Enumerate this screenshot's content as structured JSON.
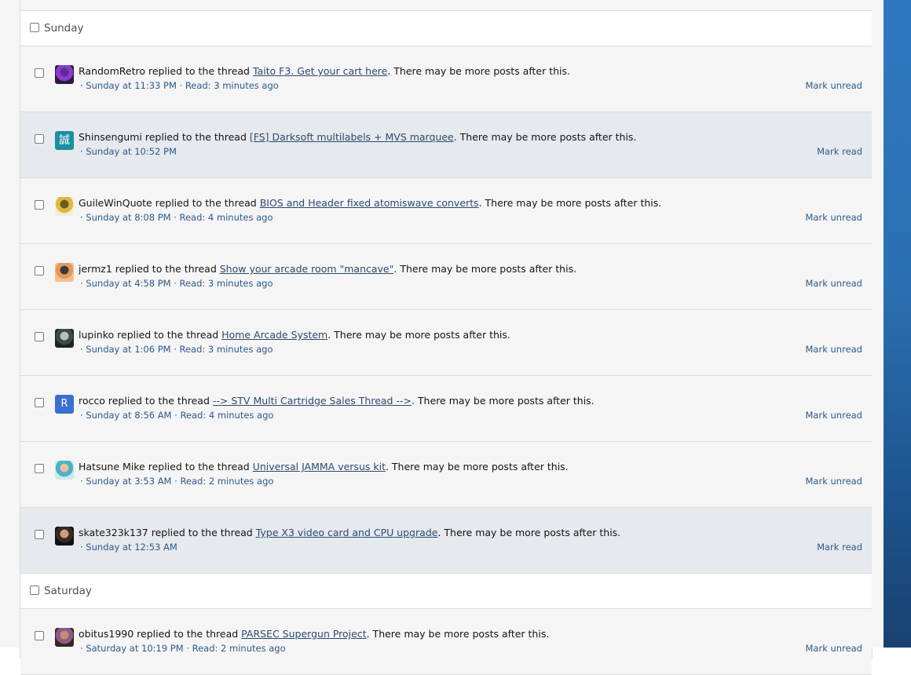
{
  "groups": [
    {
      "day": "Sunday",
      "alerts": [
        {
          "user": "RandomRetro",
          "action": " replied to the thread ",
          "thread": "Taito F3. Get your cart here",
          "suffix": ". There may be more posts after this.",
          "meta": "· Sunday at 11:33 PM · Read: 3 minutes ago",
          "mark": "Mark unread",
          "state": "read",
          "avatar": {
            "kind": "image",
            "colors": [
              "#2a1840",
              "#8a3cc8",
              "#5f2a9c"
            ]
          }
        },
        {
          "user": "Shinsengumi",
          "action": " replied to the thread ",
          "thread": "[FS] Darksoft multilabels + MVS marquee",
          "suffix": ". There may be more posts after this.",
          "meta": "· Sunday at 10:52 PM",
          "mark": "Mark read",
          "state": "unread",
          "avatar": {
            "kind": "glyph",
            "glyph": "誠",
            "bg": "#1a90a0",
            "fg": "#ffffff"
          }
        },
        {
          "user": "GuileWinQuote",
          "action": " replied to the thread ",
          "thread": "BIOS and Header fixed atomiswave converts",
          "suffix": ". There may be more posts after this.",
          "meta": "· Sunday at 8:08 PM · Read: 4 minutes ago",
          "mark": "Mark unread",
          "state": "read",
          "avatar": {
            "kind": "image",
            "colors": [
              "#f4eedd",
              "#e0b83a",
              "#6a5a2a"
            ]
          }
        },
        {
          "user": "jermz1",
          "action": " replied to the thread ",
          "thread": "Show your arcade room \"mancave\"",
          "suffix": ". There may be more posts after this.",
          "meta": "· Sunday at 4:58 PM · Read: 3 minutes ago",
          "mark": "Mark unread",
          "state": "read",
          "avatar": {
            "kind": "image",
            "colors": [
              "#f0c090",
              "#e89858",
              "#3a3a3a"
            ]
          }
        },
        {
          "user": "lupinko",
          "action": " replied to the thread ",
          "thread": "Home Arcade System",
          "suffix": ". There may be more posts after this.",
          "meta": "· Sunday at 1:06 PM · Read: 3 minutes ago",
          "mark": "Mark unread",
          "state": "read",
          "avatar": {
            "kind": "image",
            "colors": [
              "#1a2420",
              "#3c4a44",
              "#b8c0b8"
            ]
          }
        },
        {
          "user": "rocco",
          "action": " replied to the thread ",
          "thread": "--> STV Multi Cartridge Sales Thread -->",
          "suffix": ". There may be more posts after this.",
          "meta": "· Sunday at 8:56 AM · Read: 4 minutes ago",
          "mark": "Mark unread",
          "state": "read",
          "avatar": {
            "kind": "letter",
            "letter": "R"
          }
        },
        {
          "user": "Hatsune Mike",
          "action": " replied to the thread ",
          "thread": "Universal JAMMA versus kit",
          "suffix": ". There may be more posts after this.",
          "meta": "· Sunday at 3:53 AM · Read: 2 minutes ago",
          "mark": "Mark unread",
          "state": "read",
          "avatar": {
            "kind": "image",
            "colors": [
              "#cfe8ee",
              "#4ab2c4",
              "#e8c0a8"
            ]
          }
        },
        {
          "user": "skate323k137",
          "action": " replied to the thread ",
          "thread": "Type X3 video card and CPU upgrade",
          "suffix": ". There may be more posts after this.",
          "meta": "· Sunday at 12:53 AM",
          "mark": "Mark read",
          "state": "unread",
          "avatar": {
            "kind": "image",
            "colors": [
              "#101010",
              "#3a2a22",
              "#c8a080"
            ]
          }
        }
      ]
    },
    {
      "day": "Saturday",
      "alerts": [
        {
          "user": "obitus1990",
          "action": " replied to the thread ",
          "thread": "PARSEC Supergun Project",
          "suffix": ". There may be more posts after this.",
          "meta": "· Saturday at 10:19 PM · Read: 2 minutes ago",
          "mark": "Mark unread",
          "state": "read",
          "avatar": {
            "kind": "image",
            "colors": [
              "#3a2420",
              "#8a5a8a",
              "#c09070"
            ]
          }
        }
      ]
    }
  ]
}
